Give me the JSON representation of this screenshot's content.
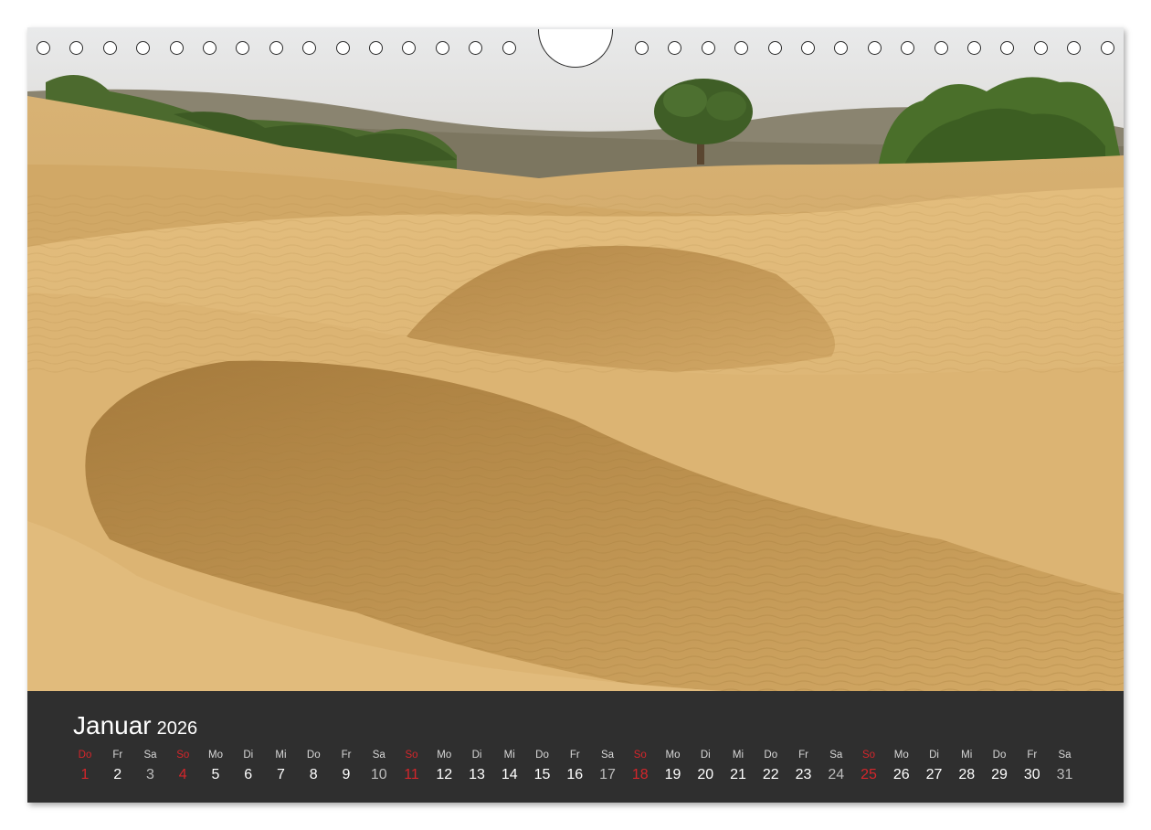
{
  "calendar": {
    "month": "Januar",
    "year": "2026",
    "days": [
      {
        "n": "1",
        "d": "Do",
        "type": "sunday"
      },
      {
        "n": "2",
        "d": "Fr",
        "type": "weekday"
      },
      {
        "n": "3",
        "d": "Sa",
        "type": "sat"
      },
      {
        "n": "4",
        "d": "So",
        "type": "sunday"
      },
      {
        "n": "5",
        "d": "Mo",
        "type": "weekday"
      },
      {
        "n": "6",
        "d": "Di",
        "type": "weekday"
      },
      {
        "n": "7",
        "d": "Mi",
        "type": "weekday"
      },
      {
        "n": "8",
        "d": "Do",
        "type": "weekday"
      },
      {
        "n": "9",
        "d": "Fr",
        "type": "weekday"
      },
      {
        "n": "10",
        "d": "Sa",
        "type": "sat"
      },
      {
        "n": "11",
        "d": "So",
        "type": "sunday"
      },
      {
        "n": "12",
        "d": "Mo",
        "type": "weekday"
      },
      {
        "n": "13",
        "d": "Di",
        "type": "weekday"
      },
      {
        "n": "14",
        "d": "Mi",
        "type": "weekday"
      },
      {
        "n": "15",
        "d": "Do",
        "type": "weekday"
      },
      {
        "n": "16",
        "d": "Fr",
        "type": "weekday"
      },
      {
        "n": "17",
        "d": "Sa",
        "type": "sat"
      },
      {
        "n": "18",
        "d": "So",
        "type": "sunday"
      },
      {
        "n": "19",
        "d": "Mo",
        "type": "weekday"
      },
      {
        "n": "20",
        "d": "Di",
        "type": "weekday"
      },
      {
        "n": "21",
        "d": "Mi",
        "type": "weekday"
      },
      {
        "n": "22",
        "d": "Do",
        "type": "weekday"
      },
      {
        "n": "23",
        "d": "Fr",
        "type": "weekday"
      },
      {
        "n": "24",
        "d": "Sa",
        "type": "sat"
      },
      {
        "n": "25",
        "d": "So",
        "type": "sunday"
      },
      {
        "n": "26",
        "d": "Mo",
        "type": "weekday"
      },
      {
        "n": "27",
        "d": "Di",
        "type": "weekday"
      },
      {
        "n": "28",
        "d": "Mi",
        "type": "weekday"
      },
      {
        "n": "29",
        "d": "Do",
        "type": "weekday"
      },
      {
        "n": "30",
        "d": "Fr",
        "type": "weekday"
      },
      {
        "n": "31",
        "d": "Sa",
        "type": "sat"
      }
    ]
  },
  "photo": {
    "subject": "sand-dunes-with-trees"
  },
  "binding": {
    "hole_count_left": 15,
    "hole_count_right": 15
  },
  "colors": {
    "band": "#2f2f2f",
    "sunday": "#d4262b",
    "sand": "#d9b06a"
  }
}
